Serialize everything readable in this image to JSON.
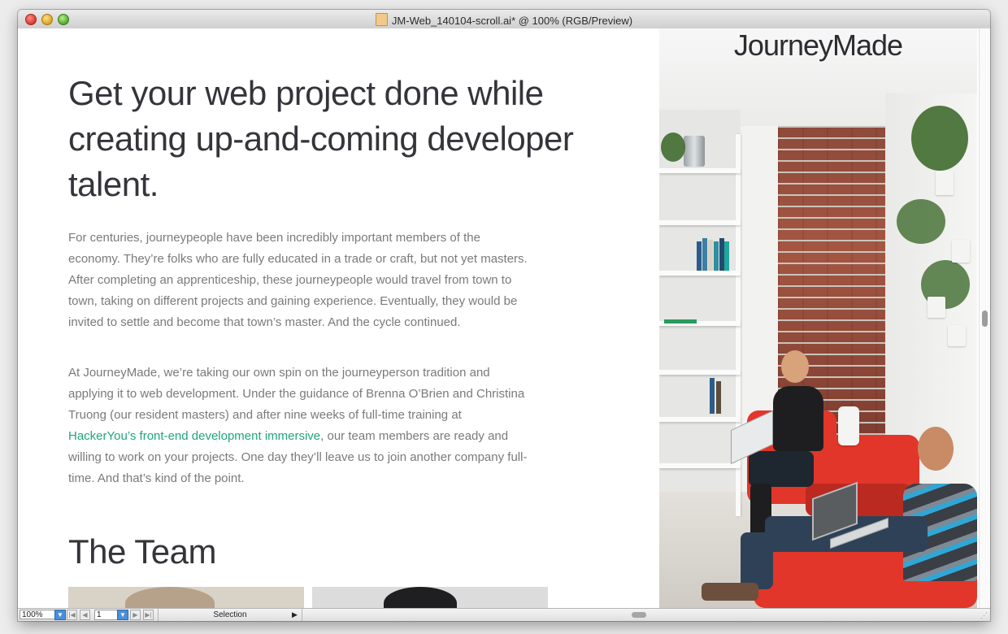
{
  "window": {
    "title": "JM-Web_140104-scroll.ai* @ 100% (RGB/Preview)"
  },
  "artboard": {
    "headline": "Get your web project done while creating up-and-coming developer talent.",
    "paragraph1": "For centuries, journeypeople have been incredibly important members of the economy. They’re folks who are fully educated in a trade or craft, but not yet masters. After completing an apprenticeship, these journeypeople would travel from town to town, taking on different projects and gaining experience. Eventually, they would be invited to settle and become that town’s master. And the cycle continued.",
    "paragraph2_before": "At JourneyMade, we’re taking our own spin on the journeyperson tradition and applying it to web development. Under the guidance of Brenna O’Brien and Christina Truong (our resident masters) and after nine weeks of full-time training at ",
    "paragraph2_link": "HackerYou’s front-end development immersive",
    "paragraph2_after": ", our team members are ready and willing to work on your projects. One day they’ll leave us to join another company full-time. And that’s kind of the point.",
    "team_title": "The Team",
    "logo": "JourneyMade"
  },
  "statusbar": {
    "zoom": "100%",
    "page": "1",
    "mode": "Selection"
  },
  "colors": {
    "headline": "#34343a",
    "body_text": "#7a7a7a",
    "link": "#1fa679",
    "chair_red": "#e2362a"
  }
}
